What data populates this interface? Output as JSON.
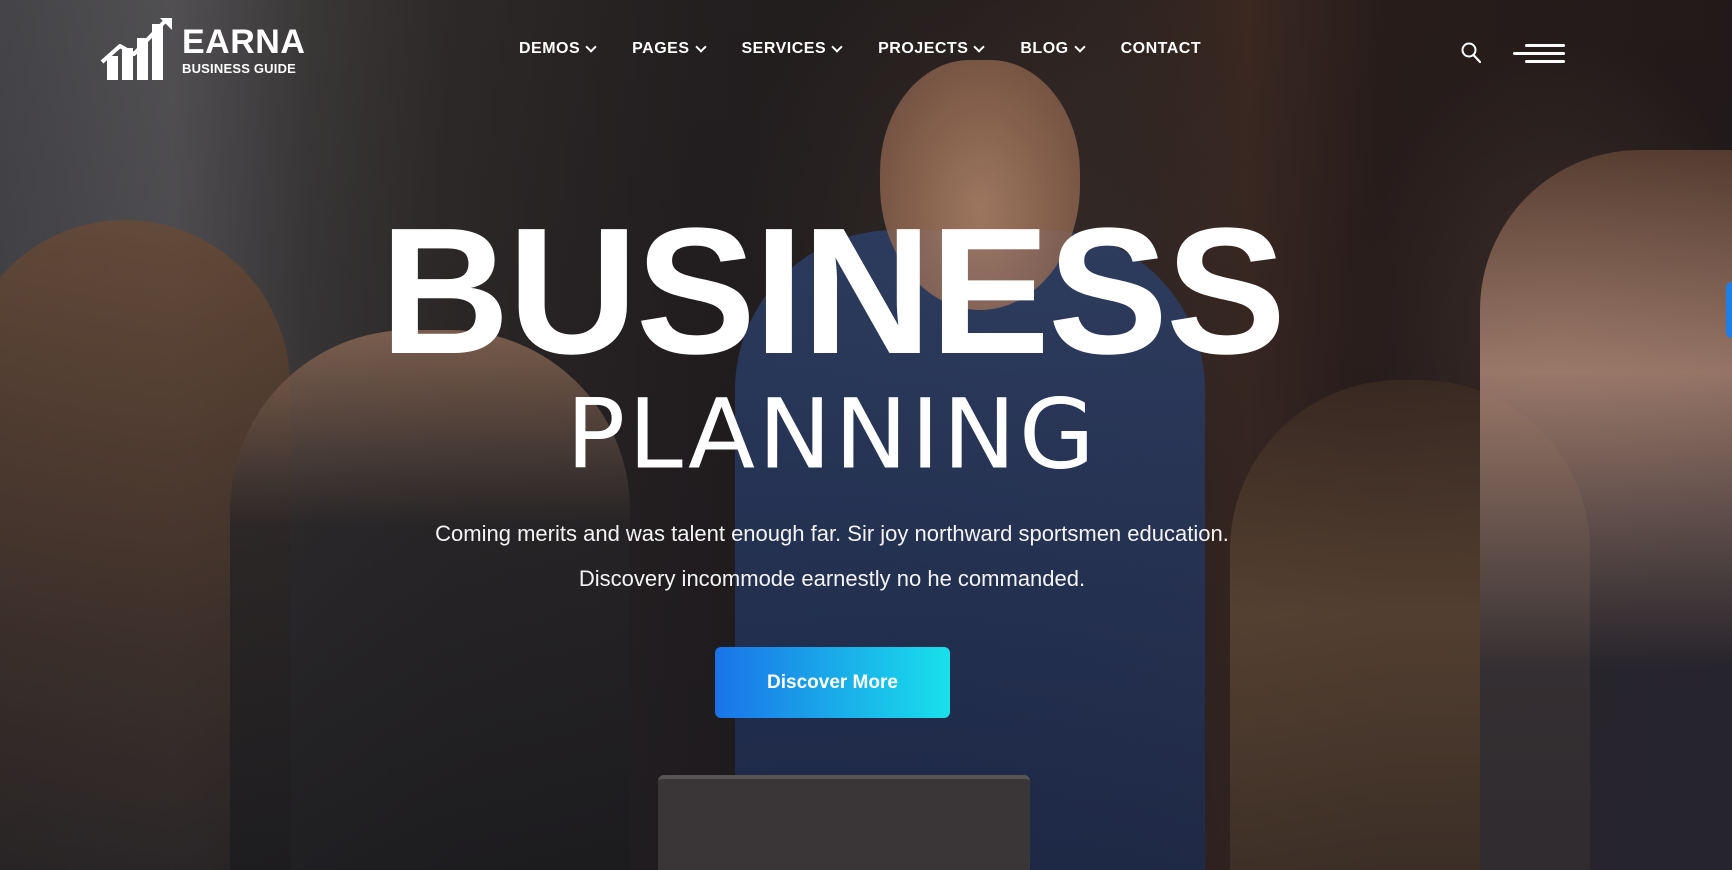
{
  "brand": {
    "name": "EARNA",
    "tagline": "BUSINESS GUIDE"
  },
  "nav": {
    "items": [
      {
        "label": "DEMOS",
        "has_dropdown": true
      },
      {
        "label": "PAGES",
        "has_dropdown": true
      },
      {
        "label": "SERVICES",
        "has_dropdown": true
      },
      {
        "label": "PROJECTS",
        "has_dropdown": true
      },
      {
        "label": "BLOG",
        "has_dropdown": true
      },
      {
        "label": "CONTACT",
        "has_dropdown": false
      }
    ],
    "search_icon": "search-icon",
    "menu_icon": "hamburger-menu-icon"
  },
  "hero": {
    "title": "BUSINESS",
    "subtitle": "PLANNING",
    "description_line1": "Coming merits and was talent enough far. Sir joy northward sportsmen education.",
    "description_line2": "Discovery incommode earnestly no he commanded.",
    "cta_label": "Discover More"
  },
  "colors": {
    "accent_gradient_start": "#1a73e8",
    "accent_gradient_end": "#19e0ea",
    "text": "#ffffff"
  }
}
